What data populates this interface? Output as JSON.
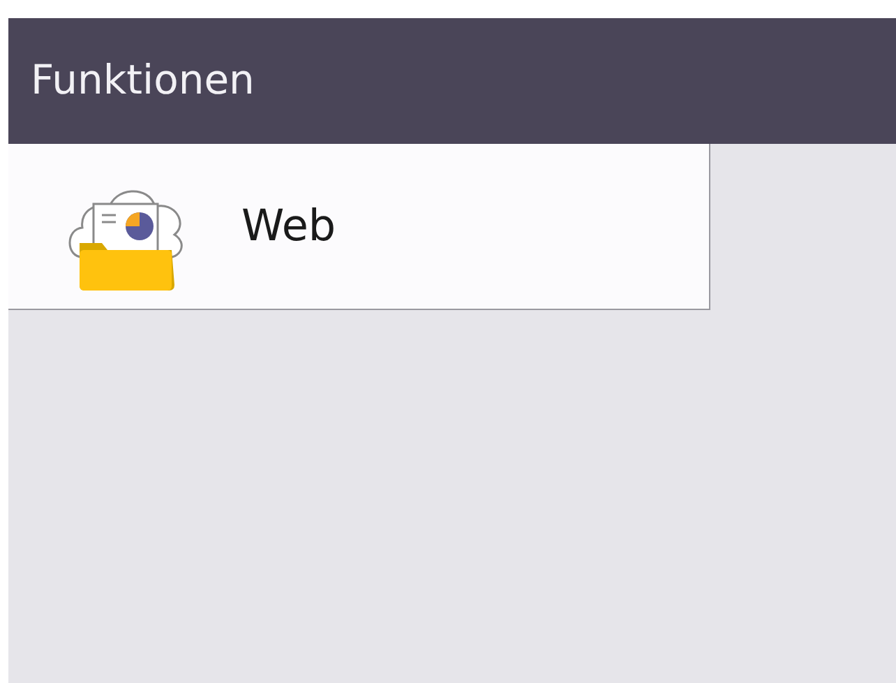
{
  "header": {
    "title": "Funktionen"
  },
  "items": [
    {
      "label": "Web"
    }
  ]
}
